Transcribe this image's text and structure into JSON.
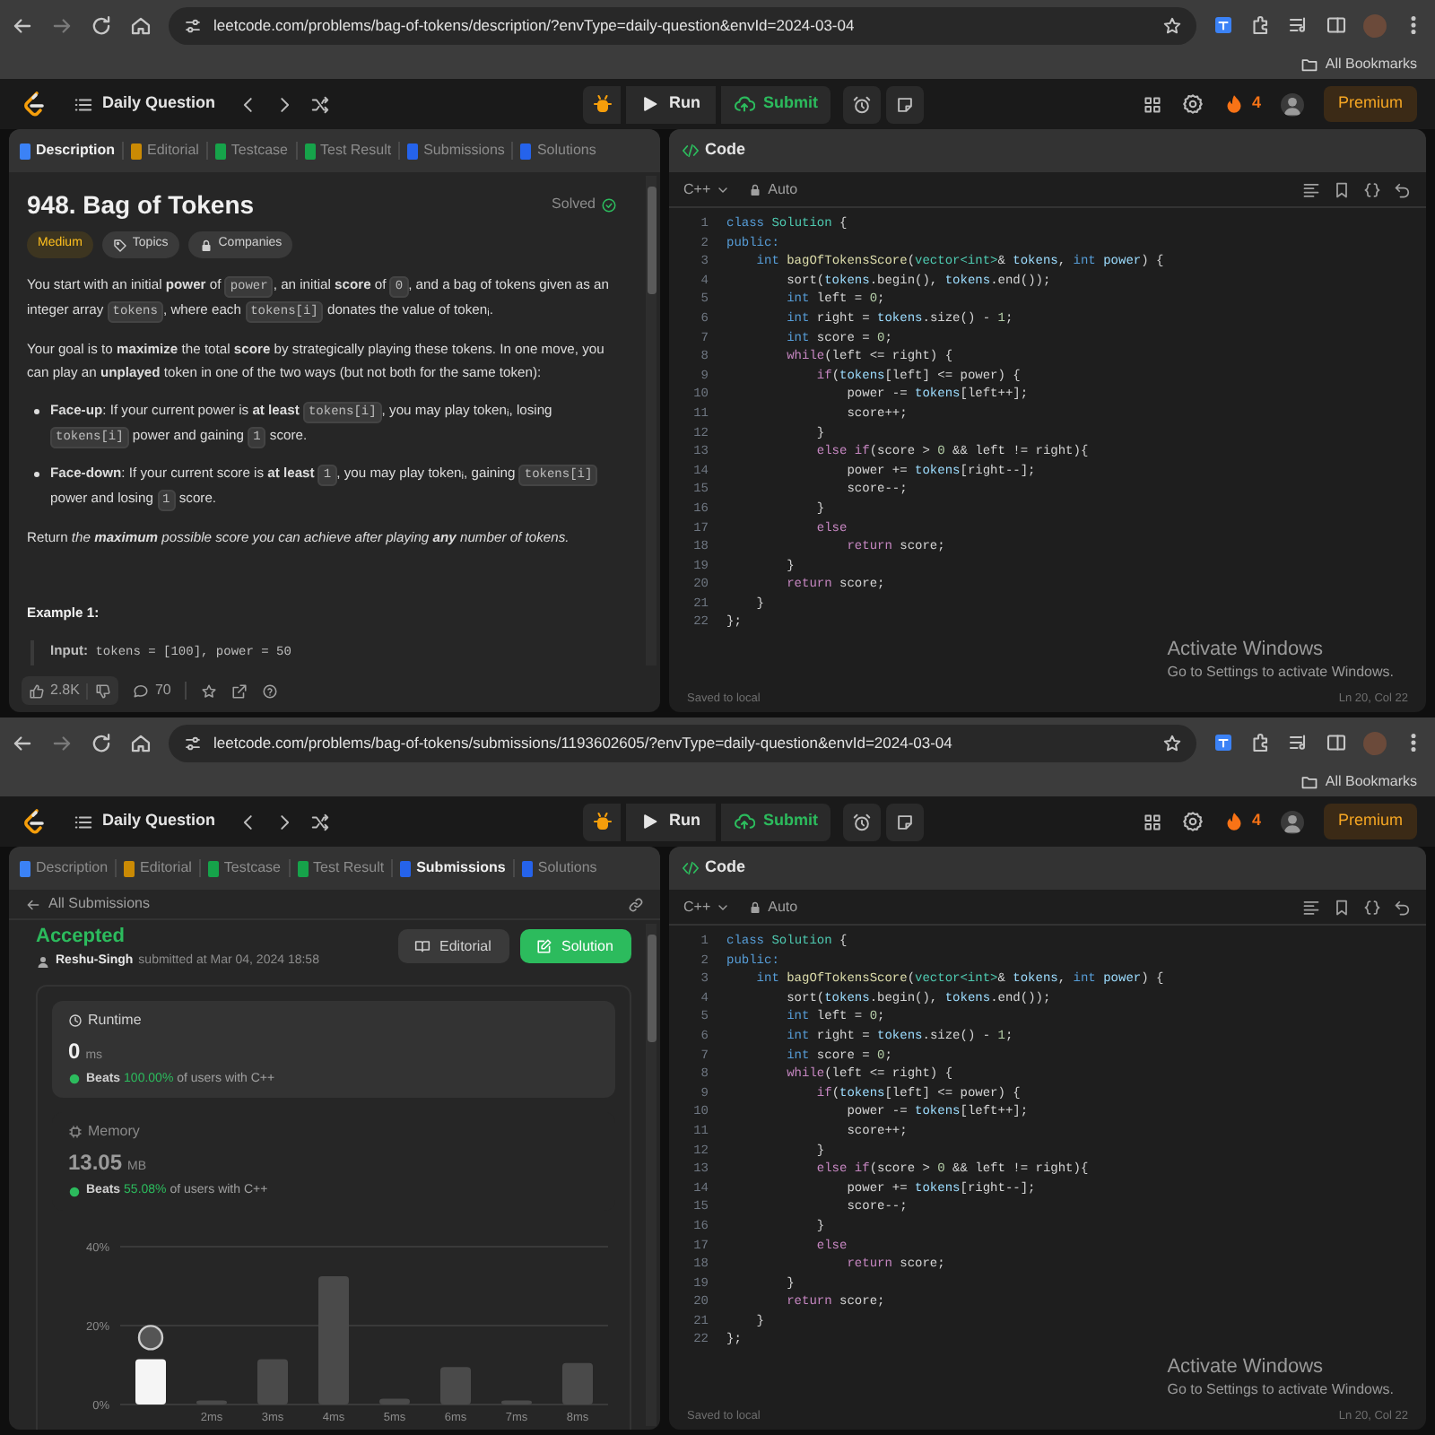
{
  "screens": [
    {
      "browser": {
        "url": "leetcode.com/problems/bag-of-tokens/description/?envType=daily-question&envId=2024-03-04",
        "bookmarks": "All Bookmarks"
      },
      "navbar": {
        "title": "Daily Question",
        "run": "Run",
        "submit": "Submit",
        "streak": "4",
        "premium": "Premium"
      },
      "left_panel": {
        "kind": "description",
        "tabs": [
          {
            "label": "Description",
            "selected": true,
            "color": "#3b82f6"
          },
          {
            "label": "Editorial",
            "selected": false,
            "color": "#ca8a04"
          },
          {
            "label": "Testcase",
            "selected": false,
            "color": "#16a34a"
          },
          {
            "label": "Test Result",
            "selected": false,
            "color": "#16a34a"
          },
          {
            "label": "Submissions",
            "selected": false,
            "color": "#2563eb"
          },
          {
            "label": "Solutions",
            "selected": false,
            "color": "#2563eb"
          }
        ],
        "title": "948. Bag of Tokens",
        "status": "Solved",
        "tags": [
          {
            "label": "Medium",
            "kind": "difficulty"
          },
          {
            "label": "Topics",
            "kind": "topics"
          },
          {
            "label": "Companies",
            "kind": "companies"
          }
        ],
        "blocks": [
          {
            "kind": "paragraph",
            "segments": [
              {
                "kind": "text",
                "text": "You start with an initial **power** of "
              },
              {
                "kind": "code",
                "text": "power"
              },
              {
                "kind": "text",
                "text": ", an initial **score** of "
              },
              {
                "kind": "code",
                "text": "0"
              },
              {
                "kind": "text",
                "text": ", and a bag of tokens given as an integer array "
              },
              {
                "kind": "code",
                "text": "tokens"
              },
              {
                "kind": "text",
                "text": ", where each "
              },
              {
                "kind": "code",
                "text": "tokens[i]"
              },
              {
                "kind": "text",
                "text": " donates the value of token$_{i}$."
              }
            ]
          },
          {
            "kind": "paragraph",
            "segments": [
              {
                "kind": "text",
                "text": "Your goal is to **maximize** the total **score** by strategically playing these tokens. In one move, you can play an **unplayed** token in one of the two ways (but not both for the same token):"
              }
            ]
          },
          {
            "kind": "bullets",
            "items": [
              [
                {
                  "kind": "text",
                  "text": "**Face-up**: If your current power is **at least** "
                },
                {
                  "kind": "code",
                  "text": "tokens[i]"
                },
                {
                  "kind": "text",
                  "text": ", you may play token$_{i}$, losing "
                },
                {
                  "kind": "code",
                  "text": "tokens[i]"
                },
                {
                  "kind": "text",
                  "text": " power and gaining "
                },
                {
                  "kind": "code",
                  "text": "1"
                },
                {
                  "kind": "text",
                  "text": " score."
                }
              ],
              [
                {
                  "kind": "text",
                  "text": "**Face-down**: If your current score is **at least** "
                },
                {
                  "kind": "code",
                  "text": "1"
                },
                {
                  "kind": "text",
                  "text": ", you may play token$_{i}$, gaining "
                },
                {
                  "kind": "code",
                  "text": "tokens[i]"
                },
                {
                  "kind": "text",
                  "text": " power and losing "
                },
                {
                  "kind": "code",
                  "text": "1"
                },
                {
                  "kind": "text",
                  "text": " score."
                }
              ]
            ]
          },
          {
            "kind": "paragraph",
            "segments": [
              {
                "kind": "text",
                "text": "Return "
              },
              {
                "kind": "italic",
                "text": "the **maximum** possible score you can achieve after playing **any** number of tokens."
              }
            ]
          },
          {
            "kind": "heading",
            "text": "Example 1:"
          },
          {
            "kind": "example",
            "segments": [
              {
                "kind": "text",
                "text": "**Input:** "
              },
              {
                "kind": "code",
                "text": "tokens = [100], power = 50"
              }
            ]
          }
        ],
        "footer": {
          "likes": "2.8K",
          "comments": "70"
        }
      },
      "code_panel": {
        "title": "Code",
        "language": "C++",
        "mode": "Auto",
        "saved": "Saved to local",
        "cursor": "Ln 20, Col 22",
        "lines": [
          {
            "n": "1",
            "s": [
              {
                "kind": "kw",
                "text": "class "
              },
              {
                "kind": "ty",
                "text": "Solution"
              },
              {
                "kind": "p",
                "text": " {"
              }
            ]
          },
          {
            "n": "2",
            "s": [
              {
                "kind": "kw",
                "text": "public:"
              }
            ]
          },
          {
            "n": "3",
            "s": [
              {
                "kind": "kw",
                "text": "    int "
              },
              {
                "kind": "fn",
                "text": "bagOfTokensScore"
              },
              {
                "kind": "p",
                "text": "("
              },
              {
                "kind": "ty",
                "text": "vector<int>"
              },
              {
                "kind": "p",
                "text": "& "
              },
              {
                "kind": "var",
                "text": "tokens"
              },
              {
                "kind": "p",
                "text": ", "
              },
              {
                "kind": "kw",
                "text": "int "
              },
              {
                "kind": "var",
                "text": "power"
              },
              {
                "kind": "p",
                "text": ") {"
              }
            ]
          },
          {
            "n": "4",
            "s": [
              {
                "kind": "p",
                "text": "        sort("
              },
              {
                "kind": "var",
                "text": "tokens"
              },
              {
                "kind": "p",
                "text": ".begin(), "
              },
              {
                "kind": "var",
                "text": "tokens"
              },
              {
                "kind": "p",
                "text": ".end());"
              }
            ]
          },
          {
            "n": "5",
            "s": [
              {
                "kind": "kw",
                "text": "        int "
              },
              {
                "kind": "p",
                "text": "left = "
              },
              {
                "kind": "num",
                "text": "0"
              },
              {
                "kind": "p",
                "text": ";"
              }
            ]
          },
          {
            "n": "6",
            "s": [
              {
                "kind": "kw",
                "text": "        int "
              },
              {
                "kind": "p",
                "text": "right = "
              },
              {
                "kind": "var",
                "text": "tokens"
              },
              {
                "kind": "p",
                "text": ".size() - "
              },
              {
                "kind": "num",
                "text": "1"
              },
              {
                "kind": "p",
                "text": ";"
              }
            ]
          },
          {
            "n": "7",
            "s": [
              {
                "kind": "kw",
                "text": "        int "
              },
              {
                "kind": "p",
                "text": "score = "
              },
              {
                "kind": "num",
                "text": "0"
              },
              {
                "kind": "p",
                "text": ";"
              }
            ]
          },
          {
            "n": "8",
            "s": [
              {
                "kind": "ctl",
                "text": "        while"
              },
              {
                "kind": "p",
                "text": "(left <= right) {"
              }
            ]
          },
          {
            "n": "9",
            "s": [
              {
                "kind": "ctl",
                "text": "            if"
              },
              {
                "kind": "p",
                "text": "("
              },
              {
                "kind": "var",
                "text": "tokens"
              },
              {
                "kind": "p",
                "text": "[left] <= power) {"
              }
            ]
          },
          {
            "n": "10",
            "s": [
              {
                "kind": "p",
                "text": "                power -= "
              },
              {
                "kind": "var",
                "text": "tokens"
              },
              {
                "kind": "p",
                "text": "[left++];"
              }
            ]
          },
          {
            "n": "11",
            "s": [
              {
                "kind": "p",
                "text": "                score++;"
              }
            ]
          },
          {
            "n": "12",
            "s": [
              {
                "kind": "p",
                "text": "            }"
              }
            ]
          },
          {
            "n": "13",
            "s": [
              {
                "kind": "ctl",
                "text": "            else if"
              },
              {
                "kind": "p",
                "text": "(score > "
              },
              {
                "kind": "num",
                "text": "0"
              },
              {
                "kind": "p",
                "text": " && left != right){"
              }
            ]
          },
          {
            "n": "14",
            "s": [
              {
                "kind": "p",
                "text": "                power += "
              },
              {
                "kind": "var",
                "text": "tokens"
              },
              {
                "kind": "p",
                "text": "[right--];"
              }
            ]
          },
          {
            "n": "15",
            "s": [
              {
                "kind": "p",
                "text": "                score--;"
              }
            ]
          },
          {
            "n": "16",
            "s": [
              {
                "kind": "p",
                "text": "            }"
              }
            ]
          },
          {
            "n": "17",
            "s": [
              {
                "kind": "ctl",
                "text": "            else"
              }
            ]
          },
          {
            "n": "18",
            "s": [
              {
                "kind": "ctl",
                "text": "                return "
              },
              {
                "kind": "p",
                "text": "score;"
              }
            ]
          },
          {
            "n": "19",
            "s": [
              {
                "kind": "p",
                "text": "        }"
              }
            ]
          },
          {
            "n": "20",
            "s": [
              {
                "kind": "ctl",
                "text": "        return "
              },
              {
                "kind": "p",
                "text": "score;"
              }
            ]
          },
          {
            "n": "21",
            "s": [
              {
                "kind": "p",
                "text": "    }"
              }
            ]
          },
          {
            "n": "22",
            "s": [
              {
                "kind": "p",
                "text": "};"
              }
            ]
          }
        ]
      },
      "os_notice": {
        "title": "Activate Windows",
        "subtitle": "Go to Settings to activate Windows."
      }
    },
    {
      "browser": {
        "url": "leetcode.com/problems/bag-of-tokens/submissions/1193602605/?envType=daily-question&envId=2024-03-04",
        "bookmarks": "All Bookmarks"
      },
      "navbar": {
        "title": "Daily Question",
        "run": "Run",
        "submit": "Submit",
        "streak": "4",
        "premium": "Premium"
      },
      "left_panel": {
        "kind": "submission",
        "tabs": [
          {
            "label": "Description",
            "selected": false,
            "color": "#3b82f6"
          },
          {
            "label": "Editorial",
            "selected": false,
            "color": "#ca8a04"
          },
          {
            "label": "Testcase",
            "selected": false,
            "color": "#16a34a"
          },
          {
            "label": "Test Result",
            "selected": false,
            "color": "#16a34a"
          },
          {
            "label": "Submissions",
            "selected": true,
            "color": "#2563eb"
          },
          {
            "label": "Solutions",
            "selected": false,
            "color": "#2563eb"
          }
        ],
        "back": "All Submissions",
        "result": "Accepted",
        "author": "Reshu-Singh",
        "submitted": "submitted at Mar 04, 2024 18:58",
        "buttons": [
          {
            "label": "Editorial",
            "kind": "secondary"
          },
          {
            "label": "Solution",
            "kind": "primary"
          }
        ],
        "stats": [
          {
            "kind": "runtime",
            "label": "Runtime",
            "value": "0",
            "unit": "ms",
            "beats": "Beats",
            "percent": "100.00%",
            "suffix": "of users with C++",
            "selected": true
          },
          {
            "kind": "memory",
            "label": "Memory",
            "value": "13.05",
            "unit": "MB",
            "beats": "Beats",
            "percent": "55.08%",
            "suffix": "of users with C++",
            "selected": false
          }
        ],
        "chart_data": {
          "type": "bar",
          "categories": [
            null,
            "2ms",
            "3ms",
            "4ms",
            "5ms",
            "6ms",
            "7ms",
            "8ms"
          ],
          "series": [
            {
              "color": "#f5f5f5",
              "values": [
                11.5,
                null,
                null,
                null,
                null,
                null,
                null,
                null
              ]
            },
            {
              "color": "#4a4a4a",
              "values": [
                null,
                1,
                11.5,
                32.5,
                1.5,
                9.5,
                1,
                10.5
              ]
            }
          ],
          "ylim": [
            0,
            40
          ],
          "yticks": [
            {
              "value": 0,
              "label": "0%"
            },
            {
              "value": 20,
              "label": "20%"
            },
            {
              "value": 40,
              "label": "40%"
            }
          ]
        }
      },
      "code_panel": {
        "title": "Code",
        "language": "C++",
        "mode": "Auto",
        "saved": "Saved to local",
        "cursor": "Ln 20, Col 22",
        "lines": [
          {
            "n": "1",
            "s": [
              {
                "kind": "kw",
                "text": "class "
              },
              {
                "kind": "ty",
                "text": "Solution"
              },
              {
                "kind": "p",
                "text": " {"
              }
            ]
          },
          {
            "n": "2",
            "s": [
              {
                "kind": "kw",
                "text": "public:"
              }
            ]
          },
          {
            "n": "3",
            "s": [
              {
                "kind": "kw",
                "text": "    int "
              },
              {
                "kind": "fn",
                "text": "bagOfTokensScore"
              },
              {
                "kind": "p",
                "text": "("
              },
              {
                "kind": "ty",
                "text": "vector<int>"
              },
              {
                "kind": "p",
                "text": "& "
              },
              {
                "kind": "var",
                "text": "tokens"
              },
              {
                "kind": "p",
                "text": ", "
              },
              {
                "kind": "kw",
                "text": "int "
              },
              {
                "kind": "var",
                "text": "power"
              },
              {
                "kind": "p",
                "text": ") {"
              }
            ]
          },
          {
            "n": "4",
            "s": [
              {
                "kind": "p",
                "text": "        sort("
              },
              {
                "kind": "var",
                "text": "tokens"
              },
              {
                "kind": "p",
                "text": ".begin(), "
              },
              {
                "kind": "var",
                "text": "tokens"
              },
              {
                "kind": "p",
                "text": ".end());"
              }
            ]
          },
          {
            "n": "5",
            "s": [
              {
                "kind": "kw",
                "text": "        int "
              },
              {
                "kind": "p",
                "text": "left = "
              },
              {
                "kind": "num",
                "text": "0"
              },
              {
                "kind": "p",
                "text": ";"
              }
            ]
          },
          {
            "n": "6",
            "s": [
              {
                "kind": "kw",
                "text": "        int "
              },
              {
                "kind": "p",
                "text": "right = "
              },
              {
                "kind": "var",
                "text": "tokens"
              },
              {
                "kind": "p",
                "text": ".size() - "
              },
              {
                "kind": "num",
                "text": "1"
              },
              {
                "kind": "p",
                "text": ";"
              }
            ]
          },
          {
            "n": "7",
            "s": [
              {
                "kind": "kw",
                "text": "        int "
              },
              {
                "kind": "p",
                "text": "score = "
              },
              {
                "kind": "num",
                "text": "0"
              },
              {
                "kind": "p",
                "text": ";"
              }
            ]
          },
          {
            "n": "8",
            "s": [
              {
                "kind": "ctl",
                "text": "        while"
              },
              {
                "kind": "p",
                "text": "(left <= right) {"
              }
            ]
          },
          {
            "n": "9",
            "s": [
              {
                "kind": "ctl",
                "text": "            if"
              },
              {
                "kind": "p",
                "text": "("
              },
              {
                "kind": "var",
                "text": "tokens"
              },
              {
                "kind": "p",
                "text": "[left] <= power) {"
              }
            ]
          },
          {
            "n": "10",
            "s": [
              {
                "kind": "p",
                "text": "                power -= "
              },
              {
                "kind": "var",
                "text": "tokens"
              },
              {
                "kind": "p",
                "text": "[left++];"
              }
            ]
          },
          {
            "n": "11",
            "s": [
              {
                "kind": "p",
                "text": "                score++;"
              }
            ]
          },
          {
            "n": "12",
            "s": [
              {
                "kind": "p",
                "text": "            }"
              }
            ]
          },
          {
            "n": "13",
            "s": [
              {
                "kind": "ctl",
                "text": "            else if"
              },
              {
                "kind": "p",
                "text": "(score > "
              },
              {
                "kind": "num",
                "text": "0"
              },
              {
                "kind": "p",
                "text": " && left != right){"
              }
            ]
          },
          {
            "n": "14",
            "s": [
              {
                "kind": "p",
                "text": "                power += "
              },
              {
                "kind": "var",
                "text": "tokens"
              },
              {
                "kind": "p",
                "text": "[right--];"
              }
            ]
          },
          {
            "n": "15",
            "s": [
              {
                "kind": "p",
                "text": "                score--;"
              }
            ]
          },
          {
            "n": "16",
            "s": [
              {
                "kind": "p",
                "text": "            }"
              }
            ]
          },
          {
            "n": "17",
            "s": [
              {
                "kind": "ctl",
                "text": "            else"
              }
            ]
          },
          {
            "n": "18",
            "s": [
              {
                "kind": "ctl",
                "text": "                return "
              },
              {
                "kind": "p",
                "text": "score;"
              }
            ]
          },
          {
            "n": "19",
            "s": [
              {
                "kind": "p",
                "text": "        }"
              }
            ]
          },
          {
            "n": "20",
            "s": [
              {
                "kind": "ctl",
                "text": "        return "
              },
              {
                "kind": "p",
                "text": "score;"
              }
            ]
          },
          {
            "n": "21",
            "s": [
              {
                "kind": "p",
                "text": "    }"
              }
            ]
          },
          {
            "n": "22",
            "s": [
              {
                "kind": "p",
                "text": "};"
              }
            ]
          }
        ]
      },
      "os_notice": {
        "title": "Activate Windows",
        "subtitle": "Go to Settings to activate Windows."
      }
    }
  ]
}
